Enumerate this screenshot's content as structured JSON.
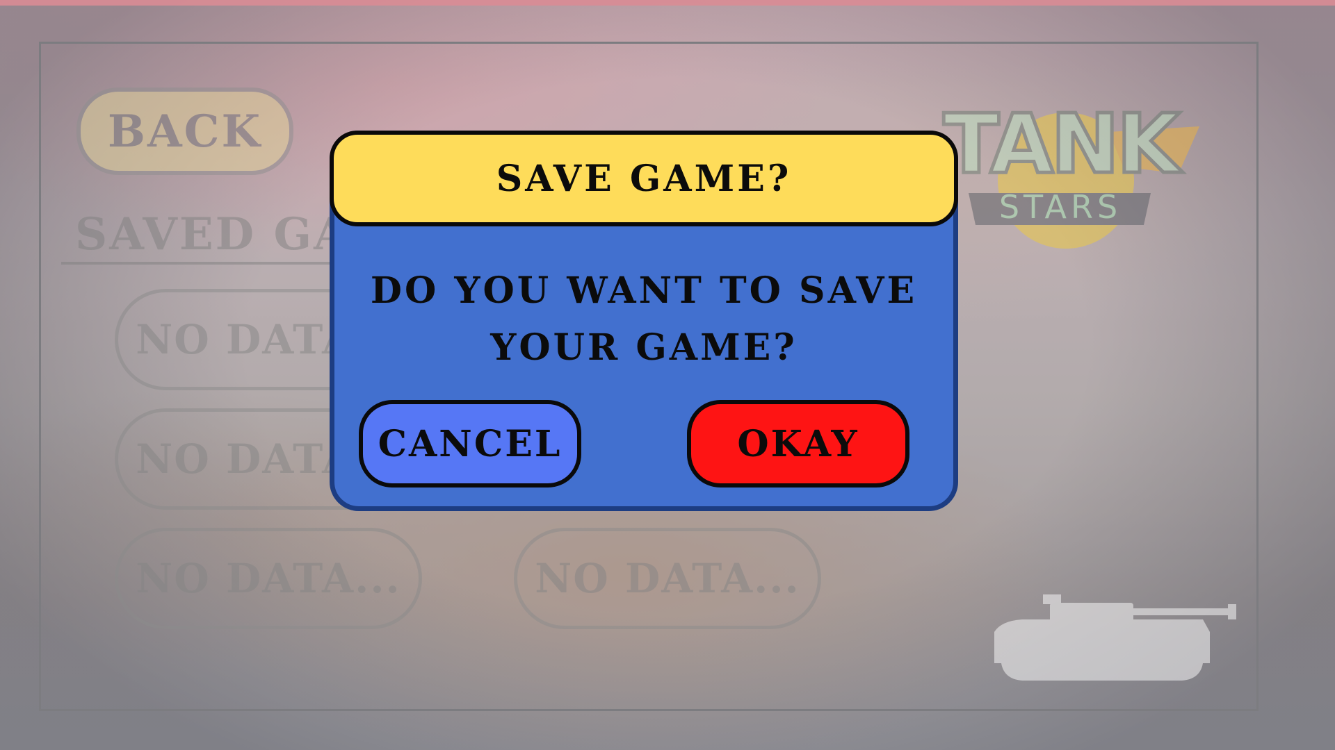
{
  "menu": {
    "back_label": "BACK",
    "saved_games_title": "SAVED GAMES",
    "slots": [
      {
        "label": "NO DATA..."
      },
      {
        "label": "NO DATA..."
      },
      {
        "label": "NO DATA..."
      },
      {
        "label": "NO DATA..."
      }
    ]
  },
  "logo": {
    "line1": "TANK",
    "line2": "STARS"
  },
  "dialog": {
    "title": "SAVE GAME?",
    "message_line1": "DO YOU WANT TO SAVE",
    "message_line2": "YOUR GAME?",
    "cancel_label": "CANCEL",
    "okay_label": "OKAY"
  },
  "colors": {
    "dialog_header": "#fedc5a",
    "dialog_body": "#4270cf",
    "cancel_button": "#5677f5",
    "okay_button": "#fe1414",
    "back_button": "#e6d79a"
  },
  "icons": {
    "tank_silhouette": "tank-icon"
  }
}
